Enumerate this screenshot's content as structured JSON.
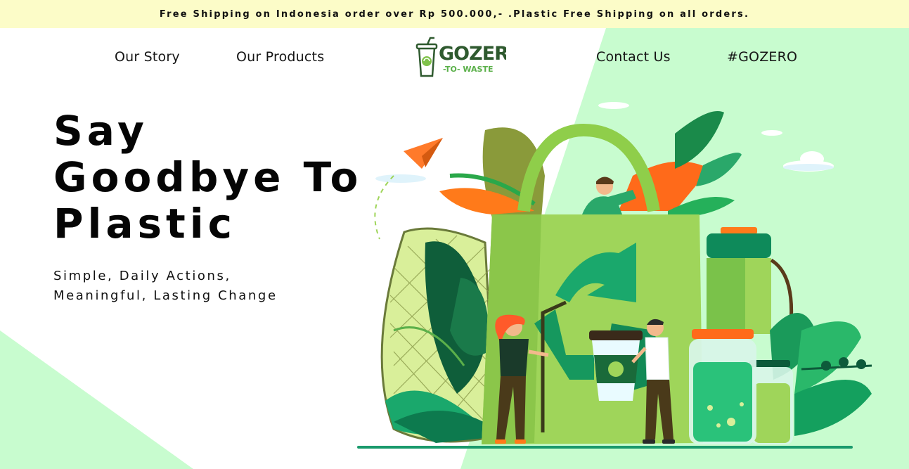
{
  "announcement": {
    "text": "Free Shipping on Indonesia order over Rp 500.000,- .Plastic Free Shipping on all orders."
  },
  "nav": {
    "left": [
      {
        "label": "Our Story"
      },
      {
        "label": "Our Products"
      }
    ],
    "right": [
      {
        "label": "Contact Us"
      },
      {
        "label": "#GOZERO"
      }
    ],
    "logo": {
      "line1": "GOZERO",
      "line2": "-TO- WASTE"
    }
  },
  "hero": {
    "title_lines": [
      "Say",
      "Goodbye To",
      "Plastic"
    ],
    "subtitle_lines": [
      "Simple, Daily Actions,",
      "Meaningful, Lasting Change"
    ]
  },
  "colors": {
    "announcement_bg": "#fcfcc8",
    "mint_bg": "#c8fccf",
    "brand_green": "#3a7d3a",
    "bag_green": "#9fd55a",
    "teal": "#1a9a6c"
  }
}
